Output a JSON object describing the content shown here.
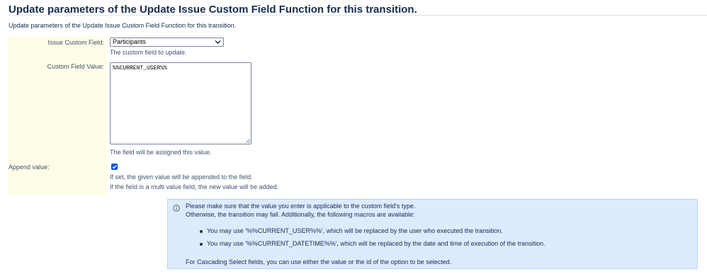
{
  "page": {
    "title": "Update parameters of the Update Issue Custom Field Function for this transition.",
    "description": "Update parameters of the Update Issue Custom Field Function for this transition."
  },
  "form": {
    "custom_field": {
      "label": "Issue Custom Field:",
      "selected": "Participants",
      "help": "The custom field to update."
    },
    "field_value": {
      "label": "Custom Field Value:",
      "value": "%%CURRENT_USER%%",
      "help": "The field will be assigned this value."
    },
    "append": {
      "label": "Append value:",
      "checked": true,
      "help_line1": "If set, the given value will be appended to the field.",
      "help_line2": "If the field is a multi value field, the new value will be added."
    }
  },
  "info": {
    "icon": "info-icon",
    "line1": "Please make sure that the value you enter is applicable to the custom field's type.",
    "line2": "Otherwise, the transition may fail. Additionally, the following macros are available:",
    "bullets": [
      "You may use '%%CURRENT_USER%%', which will be replaced by the user who executed the transition.",
      "You may use '%%CURRENT_DATETIME%%', which will be replaced by the date and time of execution of the transition."
    ],
    "footer": "For Cascading Select fields, you can use either the value or the id of the option to be selected."
  },
  "colors": {
    "label_background": "#fffde7",
    "info_background": "#deebff",
    "checkbox": "#0b57d0",
    "text": "#172b4d"
  }
}
